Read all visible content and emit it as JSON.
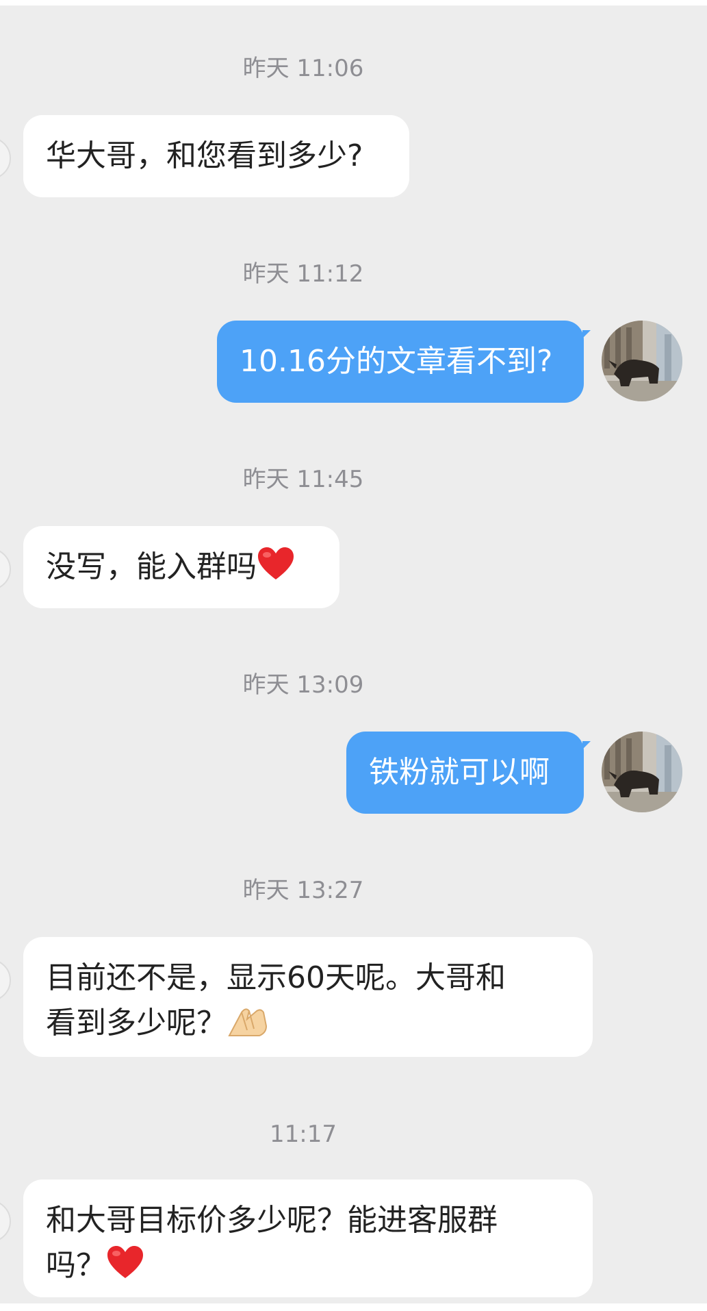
{
  "messages": [
    {
      "timestamp": "昨天 11:06",
      "sender": "other",
      "text": "华大哥，和您看到多少?"
    },
    {
      "timestamp": "昨天 11:12",
      "sender": "me",
      "text": "10.16分的文章看不到?"
    },
    {
      "timestamp": "昨天 11:45",
      "sender": "other",
      "text": "没写，能入群吗",
      "emoji": "heart-icon"
    },
    {
      "timestamp": "昨天 13:09",
      "sender": "me",
      "text": "铁粉就可以啊"
    },
    {
      "timestamp": "昨天 13:27",
      "sender": "other",
      "text_line1": "目前还不是，显示60天呢。大哥和",
      "text_line2": "看到多少呢？",
      "emoji": "pressed-hands-icon"
    },
    {
      "timestamp": "11:17",
      "sender": "other",
      "text_line1": "和大哥目标价多少呢？能进客服群",
      "text_line2": "吗？",
      "emoji": "heart-icon"
    }
  ],
  "colors": {
    "background": "#ededed",
    "my_bubble": "#4da2f7",
    "other_bubble": "#ffffff",
    "timestamp": "#8e8e93",
    "heart": "#e8262b"
  }
}
